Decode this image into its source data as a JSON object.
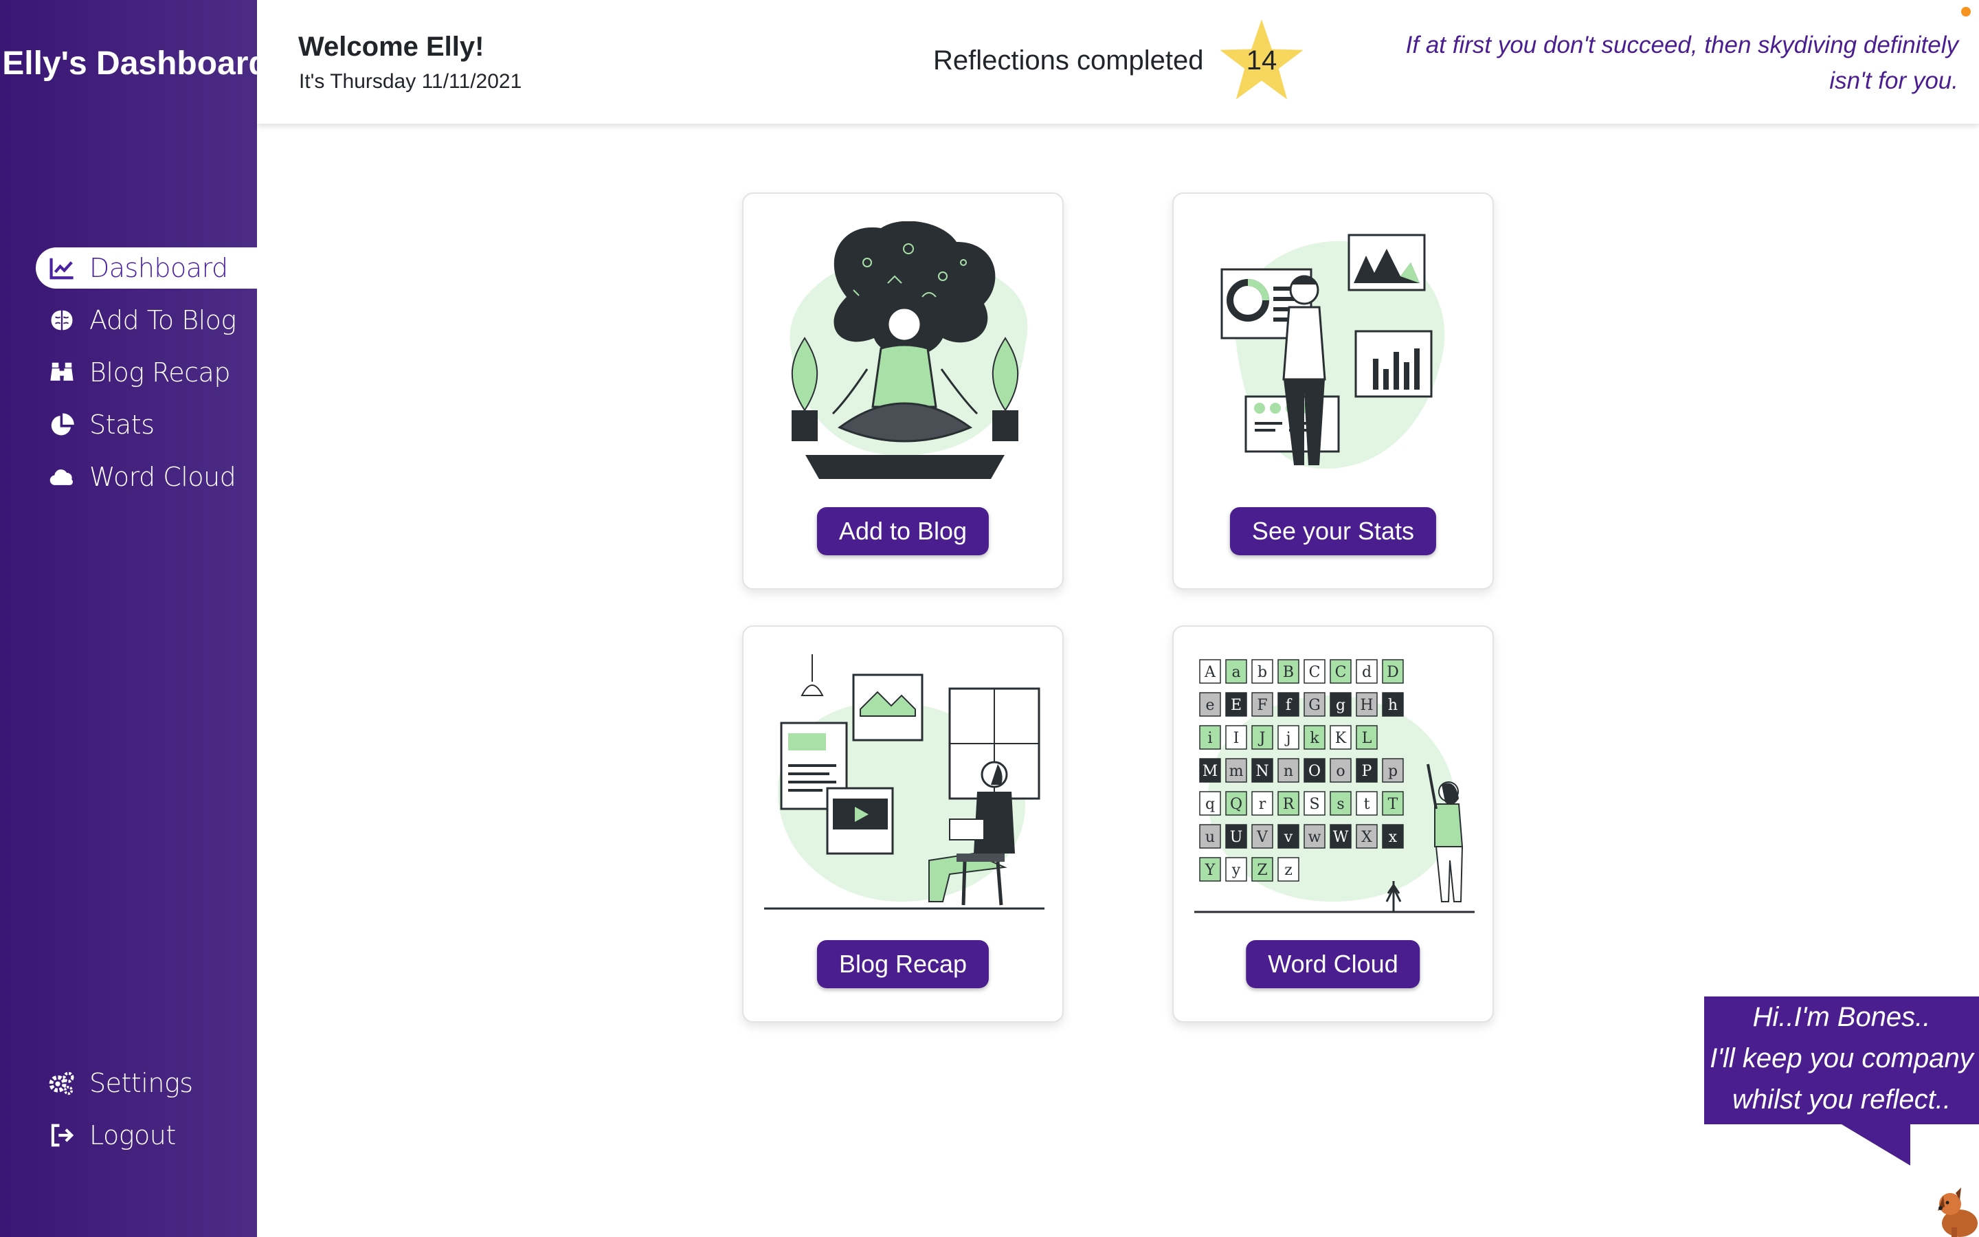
{
  "sidebar": {
    "title": "Elly's Dashboard",
    "nav": [
      {
        "label": "Dashboard",
        "icon": "line-chart-icon",
        "active": true
      },
      {
        "label": "Add To Blog",
        "icon": "brain-icon",
        "active": false
      },
      {
        "label": "Blog Recap",
        "icon": "binoculars-icon",
        "active": false
      },
      {
        "label": "Stats",
        "icon": "pie-chart-icon",
        "active": false
      },
      {
        "label": "Word Cloud",
        "icon": "cloud-icon",
        "active": false
      }
    ],
    "bottom": [
      {
        "label": "Settings",
        "icon": "gears-icon"
      },
      {
        "label": "Logout",
        "icon": "sign-out-icon"
      }
    ]
  },
  "header": {
    "welcome": "Welcome Elly!",
    "date": "It's Thursday 11/11/2021",
    "reflections_label": "Reflections completed",
    "reflections_count": "14",
    "quote": "If at first you don't succeed, then skydiving definitely isn't for you."
  },
  "cards": [
    {
      "button": "Add to Blog",
      "illustration": "meditating-woman"
    },
    {
      "button": "See your Stats",
      "illustration": "man-with-charts"
    },
    {
      "button": "Blog Recap",
      "illustration": "man-reading-board"
    },
    {
      "button": "Word Cloud",
      "illustration": "woman-alphabet-wall"
    }
  ],
  "bubble": {
    "line1": "Hi..I'm Bones..",
    "line2": "I'll keep you company",
    "line3": "whilst you reflect.."
  },
  "colors": {
    "sidebar": "#3a1675",
    "accent": "#4b1e8f",
    "star": "#f7d65e",
    "illustration_green": "#a8e0a8",
    "illustration_blob": "#e2f5e2"
  }
}
